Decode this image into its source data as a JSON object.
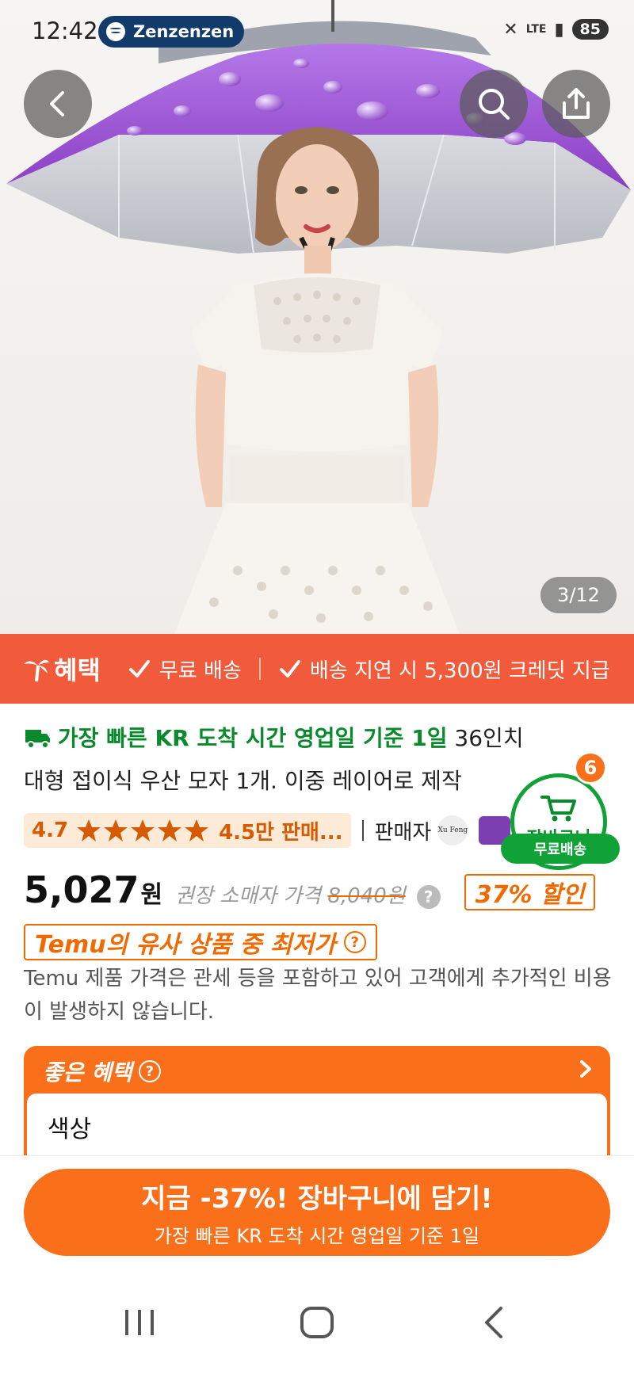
{
  "status_bar": {
    "time": "12:42",
    "media_app": "Zenzenzen",
    "network": "LTE",
    "battery": "85"
  },
  "gallery": {
    "counter": "3/12"
  },
  "benefit_bar": {
    "title": "혜택",
    "items": [
      "무료 배송",
      "배송 지연 시 5,300원 크레딧 지급"
    ]
  },
  "product": {
    "delivery_text": "가장 빠른 KR 도착 시간 영업일 기준 1일",
    "title_part1": " 36인치",
    "title_line2": "대형 접이식 우산 모자 1개. 이중 레이어로 제작",
    "rating": "4.7",
    "stars": 5,
    "sales": "4.5만 판매...",
    "seller_label": "판매자",
    "seller_name": "Xu Feng",
    "price": "5,027",
    "currency": "원",
    "rrp_label": "권장 소매자 가격",
    "rrp_value": "8,040원",
    "discount": "37% 할인",
    "lowest_price_tag": "Temu의 유사 상품 중 최저가",
    "notice": "Temu 제품 가격은 관세 등을 포함하고 있어 고객에게 추가적인 비용이 발생하지 않습니다."
  },
  "benefits_card": {
    "title": "좋은 혜택",
    "color_label": "색상"
  },
  "cart_float": {
    "count": "6",
    "label": "장바구니",
    "free_shipping": "무료배송"
  },
  "cta": {
    "main": "지금 -37%! 장바구니에 담기!",
    "sub": "가장 빠른 KR 도착 시간 영업일 기준 1일"
  },
  "colors": {
    "temu_orange": "#f96f1a",
    "benefit_red": "#f25a3c",
    "delivery_green": "#0a8a2c",
    "umbrella_purple": "#9b4fd0"
  }
}
